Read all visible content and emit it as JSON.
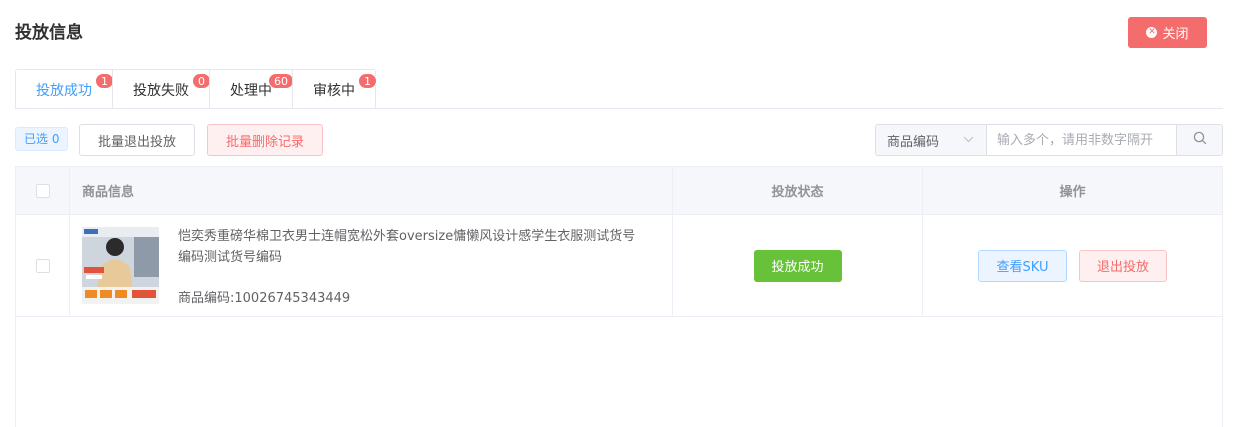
{
  "page": {
    "title": "投放信息",
    "close_label": "关闭"
  },
  "tabs": [
    {
      "label": "投放成功",
      "badge": "1",
      "active": true
    },
    {
      "label": "投放失败",
      "badge": "0",
      "active": false
    },
    {
      "label": "处理中",
      "badge": "60",
      "active": false
    },
    {
      "label": "审核中",
      "badge": "1",
      "active": false
    }
  ],
  "toolbar": {
    "selected_label": "已选 0",
    "batch_exit_label": "批量退出投放",
    "batch_delete_label": "批量删除记录",
    "search_type": "商品编码",
    "search_placeholder": "输入多个，请用非数字隔开"
  },
  "table": {
    "headers": {
      "info": "商品信息",
      "status": "投放状态",
      "ops": "操作"
    },
    "rows": [
      {
        "name": "恺奕秀重磅华棉卫衣男士连帽宽松外套oversize慵懒风设计感学生衣服测试货号编码测试货号编码",
        "code": "商品编码:10026745343449",
        "status": "投放成功",
        "view_sku_label": "查看SKU",
        "exit_label": "退出投放"
      }
    ]
  },
  "colors": {
    "primary": "#409eff",
    "danger": "#f56c6c",
    "success": "#67c23a"
  }
}
